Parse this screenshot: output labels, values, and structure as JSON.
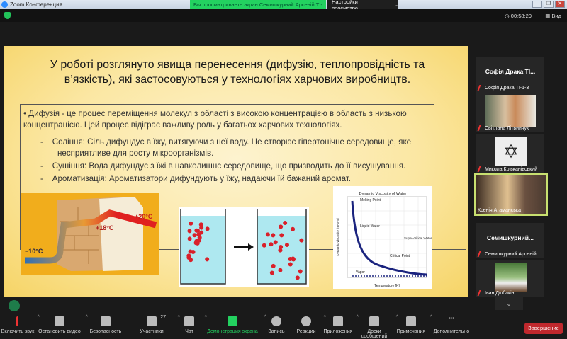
{
  "window": {
    "title": "Zoom Конференция",
    "share_banner": "Вы просматриваете экран Семишкурний Арсеній ТІ-",
    "view_settings": "Настройки просмотра",
    "timer": "00:58:29",
    "view": "Вид"
  },
  "slide": {
    "title": "У роботі розглянуто явища перенесення (дифузію, теплопровідність та в’язкість), які застосовуються у технологіях харчових виробництв.",
    "intro": "• Дифузія - це процес переміщення молекул з області з високою концентрацією в область з низькою концентрацією. Цей процес відіграє важливу роль у багатьох харчових технологіях.",
    "bullets": [
      "-    Соління: Сіль дифундує в їжу, витягуючи з неї воду. Це створює гіпертонічне середовище, яке несприятливе для росту мікроорганізмів.",
      "-    Сушіння: Вода дифундує з їжі в навколишнє середовище, що призводить до її висушування.",
      "-    Ароматизація: Ароматизатори дифундують у їжу, надаючи їй бажаний аромат."
    ],
    "wall": {
      "hot": "+20°C",
      "mid": "+18°C",
      "cold": "−10°C"
    },
    "viscosity": {
      "title": "Dynamic Viscosity of Water",
      "melting": "Melting Point",
      "liquid": "Liquid Water",
      "critical": "Critical Point",
      "super": "Super-critical Water",
      "vapor": "Vapor",
      "xlabel": "Temperature [K]",
      "ylabel": "Dynamic Viscosity [mPa·s]"
    }
  },
  "participants": [
    {
      "big": "Софія Драка ТІ...",
      "name": "Софія Драка ТІ-1-3"
    },
    {
      "name": "Світлана Літвинчук"
    },
    {
      "name": "Микола Крівканівський"
    },
    {
      "name": "Ксенія Атаманська"
    },
    {
      "big": "Семишкурний...",
      "name": "Семишкурний Арсеній ..."
    },
    {
      "name": "Іван Дюбакін"
    }
  ],
  "toolbar": [
    {
      "label": "Включить звук",
      "icon": "mic-muted-icon"
    },
    {
      "label": "Остановить видео",
      "icon": "video-icon"
    },
    {
      "label": "Безопасность",
      "icon": "shield-icon"
    },
    {
      "label": "Участники",
      "icon": "participants-icon",
      "count": "27"
    },
    {
      "label": "Чат",
      "icon": "chat-icon"
    },
    {
      "label": "Демонстрация экрана",
      "icon": "share-screen-icon"
    },
    {
      "label": "Запись",
      "icon": "record-icon"
    },
    {
      "label": "Реакции",
      "icon": "reactions-icon"
    },
    {
      "label": "Приложения",
      "icon": "apps-icon"
    },
    {
      "label": "Доски сообщений",
      "icon": "whiteboard-icon"
    },
    {
      "label": "Примечания",
      "icon": "notes-icon"
    },
    {
      "label": "Дополнительно",
      "icon": "more-icon"
    }
  ],
  "end_label": "Завершение",
  "colors": {
    "share_green": "#23d160",
    "end_red": "#c0282d"
  }
}
